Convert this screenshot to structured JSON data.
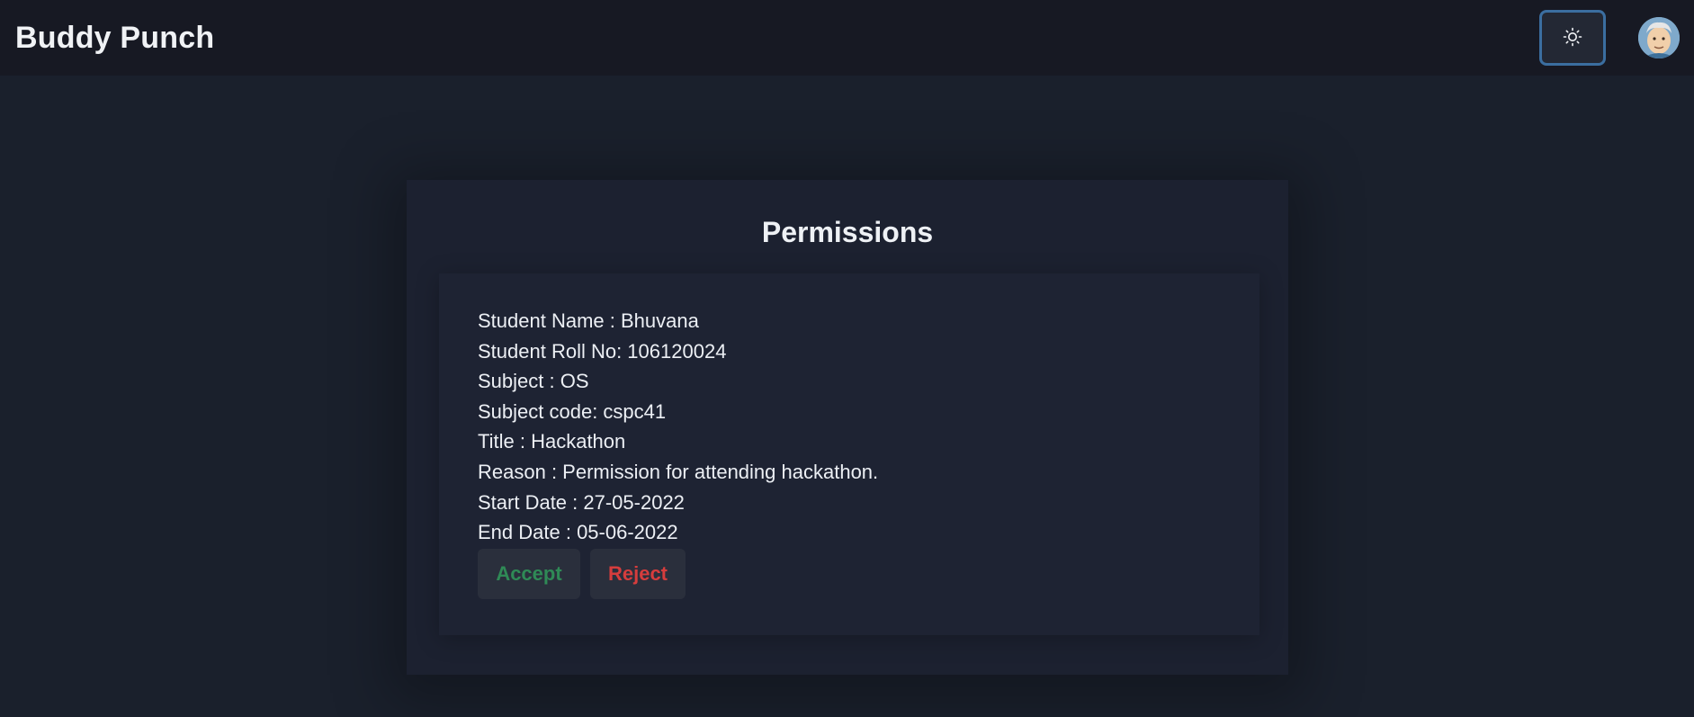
{
  "header": {
    "brand": "Buddy Punch",
    "theme_toggle_icon": "sun-icon",
    "avatar_icon": "user-avatar"
  },
  "permissions": {
    "title": "Permissions",
    "request": {
      "student_name": "Student Name : Bhuvana",
      "roll_no": "Student Roll No: 106120024",
      "subject": "Subject : OS",
      "subject_code": "Subject code: cspc41",
      "title": "Title : Hackathon",
      "reason": "Reason : Permission for attending hackathon.",
      "start_date": "Start Date : 27-05-2022",
      "end_date": "End Date : 05-06-2022"
    },
    "accept_label": "Accept",
    "reject_label": "Reject"
  },
  "colors": {
    "background": "#1a202c",
    "topbar": "#171923",
    "accept": "#2f8a56",
    "reject": "#d63d3d",
    "focus_ring": "#3b6ea0"
  }
}
